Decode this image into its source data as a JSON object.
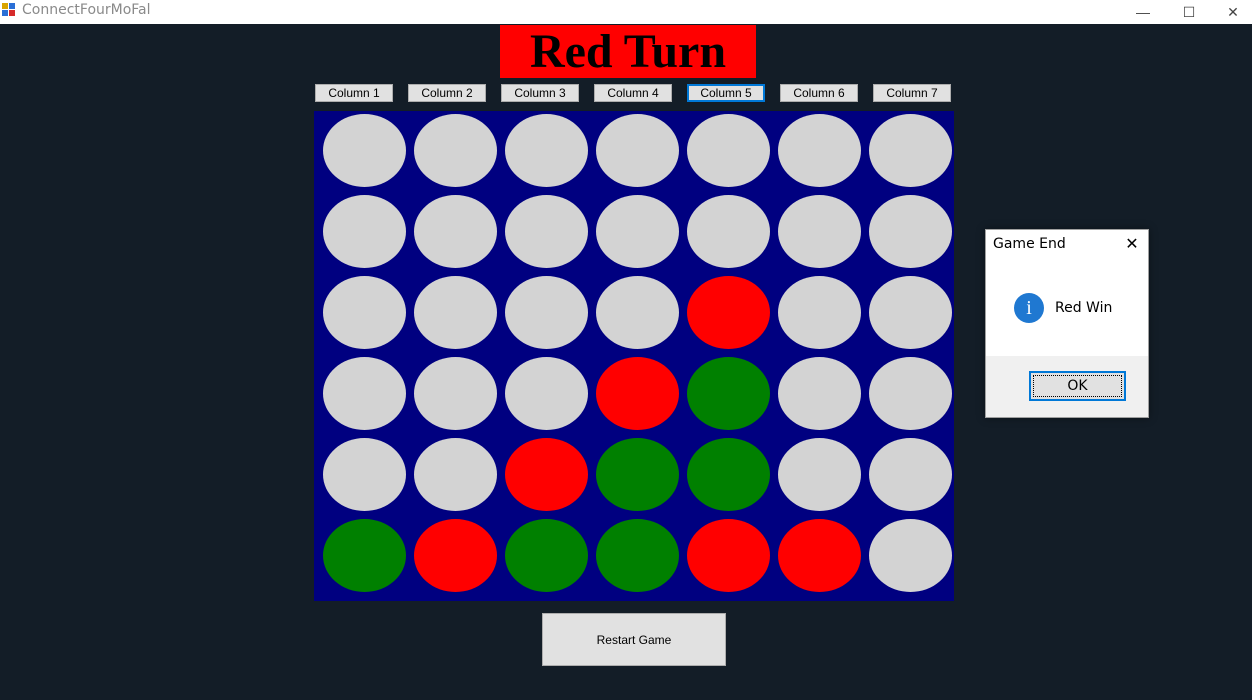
{
  "window": {
    "title": "ConnectFourMoFal",
    "minimize": "—",
    "maximize": "☐",
    "close": "✕"
  },
  "turn": {
    "label": "Red Turn",
    "color": "#ff0000"
  },
  "columns": [
    "Column 1",
    "Column 2",
    "Column 3",
    "Column 4",
    "Column 5",
    "Column 6",
    "Column 7"
  ],
  "focused_column": 5,
  "board": {
    "rows": [
      [
        "empty",
        "empty",
        "empty",
        "empty",
        "empty",
        "empty",
        "empty"
      ],
      [
        "empty",
        "empty",
        "empty",
        "empty",
        "empty",
        "empty",
        "empty"
      ],
      [
        "empty",
        "empty",
        "empty",
        "empty",
        "red",
        "empty",
        "empty"
      ],
      [
        "empty",
        "empty",
        "empty",
        "red",
        "green",
        "empty",
        "empty"
      ],
      [
        "empty",
        "empty",
        "red",
        "green",
        "green",
        "empty",
        "empty"
      ],
      [
        "green",
        "red",
        "green",
        "green",
        "red",
        "red",
        "empty"
      ]
    ],
    "colors": {
      "background": "#000080",
      "empty": "#d3d3d3",
      "red": "#ff0000",
      "green": "#008000"
    }
  },
  "restart_label": "Restart Game",
  "dialog": {
    "title": "Game End",
    "close": "✕",
    "icon": "info-icon",
    "icon_glyph": "i",
    "message": "Red Win",
    "ok_label": "OK"
  }
}
